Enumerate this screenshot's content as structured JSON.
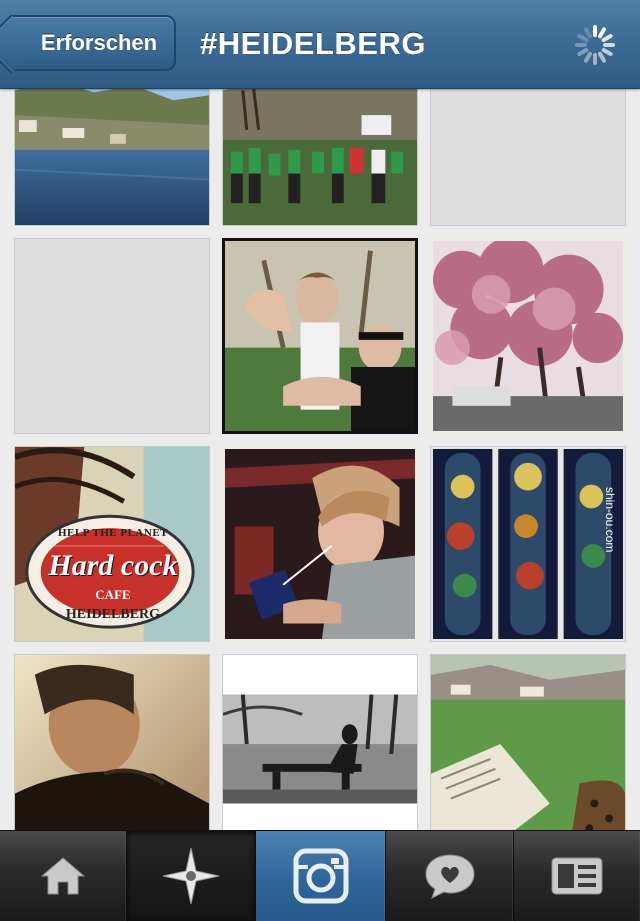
{
  "nav": {
    "back_label": "Erforschen",
    "title": "#HEIDELBERG"
  },
  "tabs": [
    {
      "id": "home",
      "icon": "home-icon"
    },
    {
      "id": "explore",
      "icon": "compass-star-icon",
      "selected": true
    },
    {
      "id": "camera",
      "icon": "camera-icon"
    },
    {
      "id": "news",
      "icon": "speech-heart-icon"
    },
    {
      "id": "profile",
      "icon": "profile-card-icon"
    }
  ],
  "photos": {
    "sign_line1": "HELP THE PLANET",
    "sign_line2": "Hard cock",
    "sign_line3": "CAFE",
    "sign_line4": "HEIDELBERG",
    "tattoo_watermark": "shin-ou.com"
  },
  "colors": {
    "nav_blue": "#3d6a94",
    "tab_active_blue": "#2f6598",
    "placeholder_gray": "#dcdcdc"
  }
}
